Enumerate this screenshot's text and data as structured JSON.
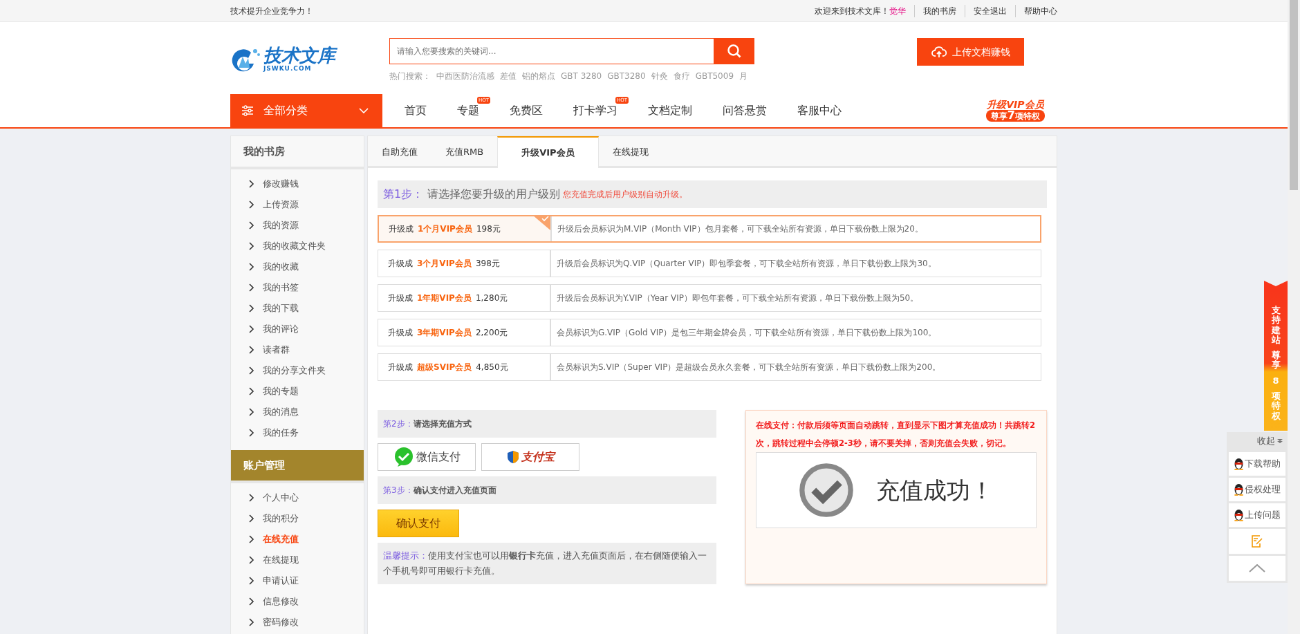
{
  "topbar": {
    "slogan": "技术提升企业竞争力！",
    "welcome": "欢迎来到技术文库！",
    "username": "觉华",
    "links": [
      "我的书房",
      "安全退出",
      "帮助中心"
    ]
  },
  "header": {
    "logo": {
      "name": "技术文库",
      "domain": "JSWKU.COM"
    },
    "search": {
      "placeholder": "请输入您要搜索的关键词..."
    },
    "hot_label": "热门搜索：",
    "hot_terms": [
      "中西医防治流感",
      "差值",
      "铝的熔点",
      "GBT 3280",
      "GBT3280",
      "针灸",
      "食疗",
      "GBT5009",
      "月"
    ],
    "upload_button": "上传文档赚钱"
  },
  "nav": {
    "category_button": "全部分类",
    "items": [
      {
        "label": "首页"
      },
      {
        "label": "专题",
        "badge": "HOT"
      },
      {
        "label": "免费区"
      },
      {
        "label": "打卡学习",
        "badge": "HOT"
      },
      {
        "label": "文档定制"
      },
      {
        "label": "问答悬赏"
      },
      {
        "label": "客服中心"
      }
    ],
    "promo": {
      "title": "升级VIP会员",
      "prefix": "尊享",
      "count": "7",
      "suffix": "项特权"
    }
  },
  "sidebar": {
    "sections": [
      {
        "title": "我的书房",
        "highlighted": false,
        "items": [
          {
            "label": "修改赚钱",
            "selected": false
          },
          {
            "label": "上传资源",
            "selected": false
          },
          {
            "label": "我的资源",
            "selected": false
          },
          {
            "label": "我的收藏文件夹",
            "selected": false
          },
          {
            "label": "我的收藏",
            "selected": false
          },
          {
            "label": "我的书签",
            "selected": false
          },
          {
            "label": "我的下载",
            "selected": false
          },
          {
            "label": "我的评论",
            "selected": false
          },
          {
            "label": "读者群",
            "selected": false
          },
          {
            "label": "我的分享文件夹",
            "selected": false
          },
          {
            "label": "我的专题",
            "selected": false
          },
          {
            "label": "我的消息",
            "selected": false
          },
          {
            "label": "我的任务",
            "selected": false
          }
        ]
      },
      {
        "title": "账户管理",
        "highlighted": true,
        "items": [
          {
            "label": "个人中心",
            "selected": false
          },
          {
            "label": "我的积分",
            "selected": false
          },
          {
            "label": "在线充值",
            "selected": true
          },
          {
            "label": "在线提现",
            "selected": false
          },
          {
            "label": "申请认证",
            "selected": false
          },
          {
            "label": "信息修改",
            "selected": false
          },
          {
            "label": "密码修改",
            "selected": false
          }
        ]
      }
    ]
  },
  "tabs": [
    {
      "label": "自助充值",
      "selected": false
    },
    {
      "label": "充值RMB",
      "selected": false
    },
    {
      "label": "升级VIP会员",
      "selected": true
    },
    {
      "label": "在线提现",
      "selected": false
    }
  ],
  "step1": {
    "label": "第1步：",
    "title": "请选择您要升级的用户级别",
    "note": "您充值完成后用户级别自动升级。"
  },
  "plans": [
    {
      "prefix": "升级成",
      "name": "1个月VIP会员",
      "price": "198元",
      "description": "升级后会员标识为M.VIP（Month VIP）包月套餐，可下载全站所有资源，单日下载份数上限为20。",
      "selected": true
    },
    {
      "prefix": "升级成",
      "name": "3个月VIP会员",
      "price": "398元",
      "description": "升级后会员标识为Q.VIP（Quarter VIP）即包季套餐，可下载全站所有资源，单日下载份数上限为30。",
      "selected": false
    },
    {
      "prefix": "升级成",
      "name": "1年期VIP会员",
      "price": "1,280元",
      "description": "升级后会员标识为Y.VIP（Year VIP）即包年套餐，可下载全站所有资源，单日下载份数上限为50。",
      "selected": false
    },
    {
      "prefix": "升级成",
      "name": "3年期VIP会员",
      "price": "2,200元",
      "description": "会员标识为G.VIP（Gold VIP）是包三年期金牌会员，可下载全站所有资源，单日下载份数上限为100。",
      "selected": false
    },
    {
      "prefix": "升级成",
      "name": "超级SVIP会员",
      "price": "4,850元",
      "description": "会员标识为S.VIP（Super VIP）是超级会员永久套餐，可下载全站所有资源，单日下载份数上限为200。",
      "selected": false
    }
  ],
  "step2": {
    "label": "第2步：",
    "title": "请选择充值方式"
  },
  "payment_methods": [
    {
      "kind": "wechat",
      "label": "微信支付"
    },
    {
      "kind": "alipay",
      "label": "支付宝"
    }
  ],
  "step3": {
    "label": "第3步：",
    "title": "确认支付进入充值页面"
  },
  "confirm_button": "确认支付",
  "tip": {
    "label": "温馨提示：",
    "text": "使用支付宝也可以用**银行卡**充值，进入充值页面后，在右侧随便输入一个手机号即可用银行卡充值。"
  },
  "notice": {
    "text": "在线支付：付款后须等页面自动跳转，直到显示下图才算充值成功！共跳转2次，跳转过程中会停顿2-3秒，请不要关掉，否则充值会失败，切记。",
    "success_text": "充值成功！"
  },
  "ribbon": {
    "texts": [
      "支持建站",
      "尊享",
      "8",
      "项特权"
    ]
  },
  "side_panel": {
    "collapse_label": "收起",
    "links": [
      "下载帮助",
      "侵权处理",
      "上传问题"
    ]
  }
}
